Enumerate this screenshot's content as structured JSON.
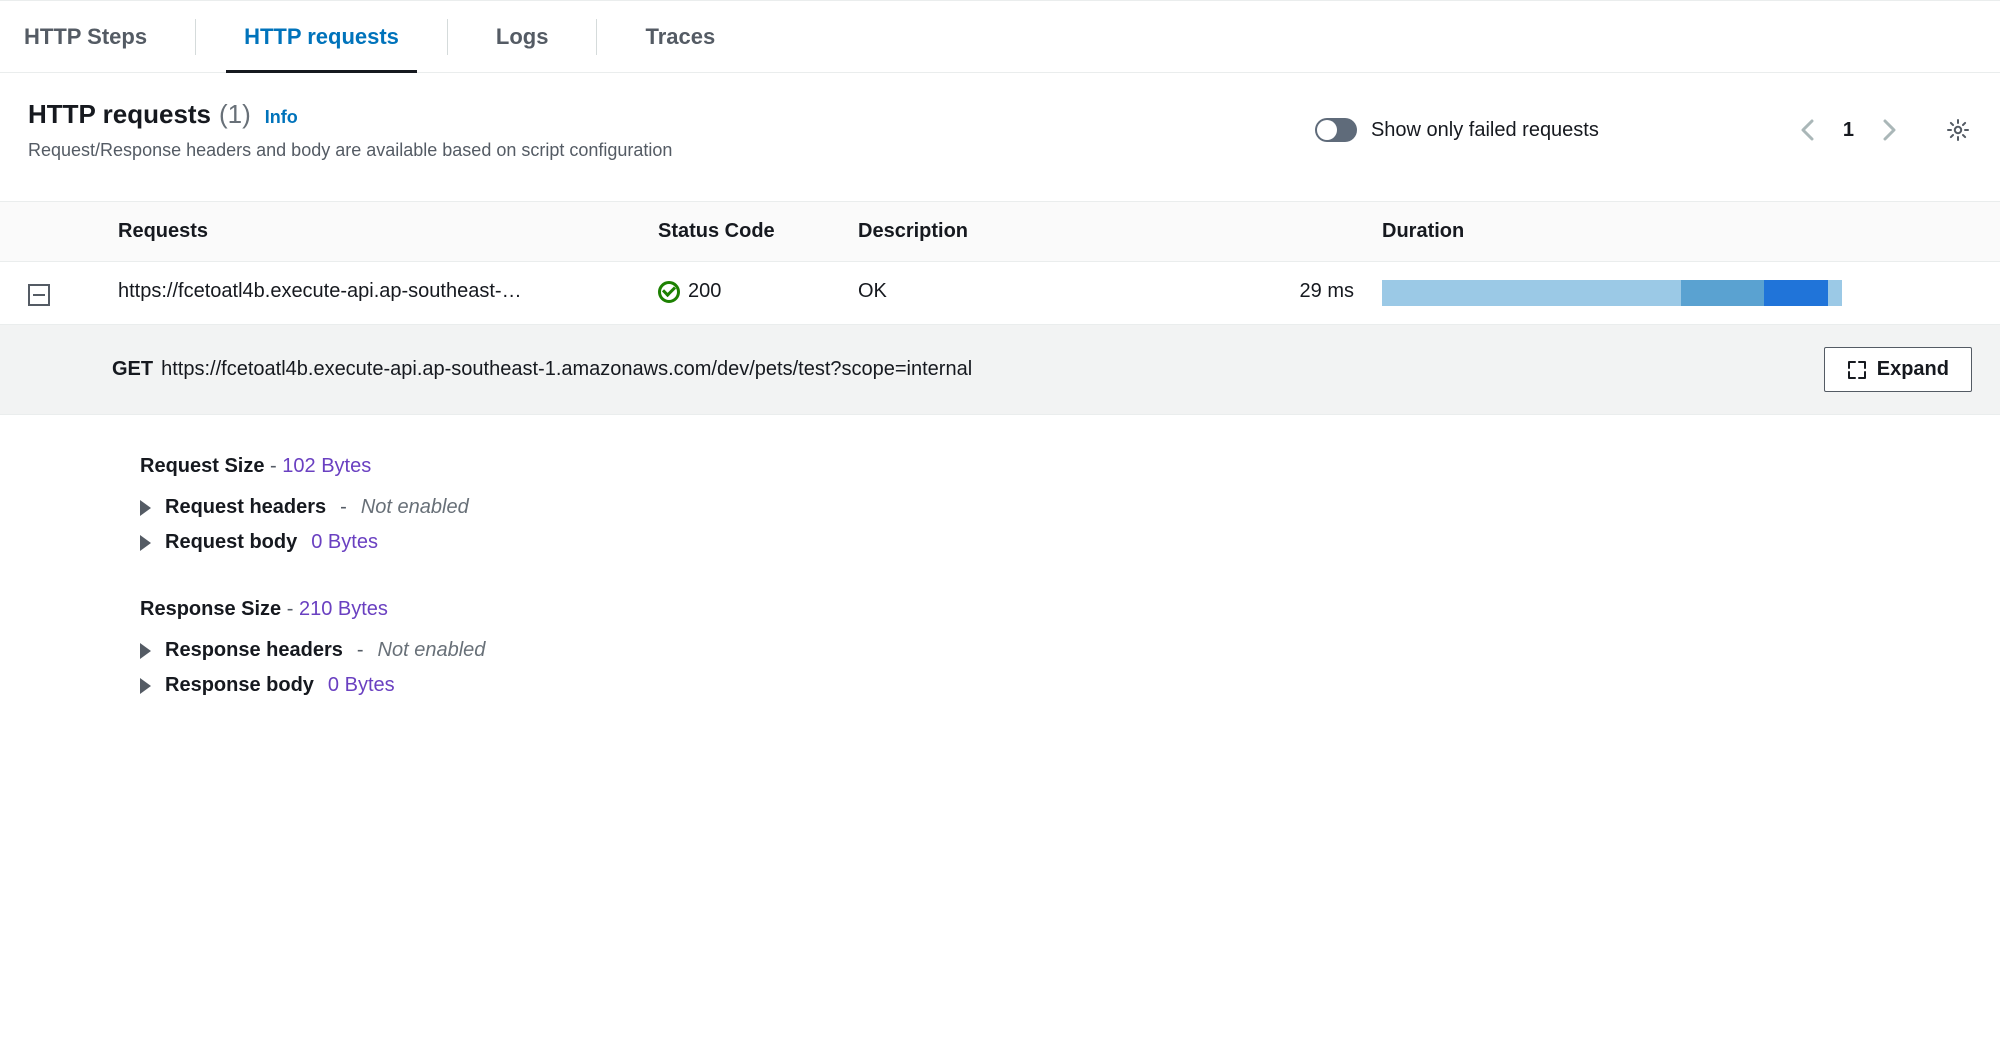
{
  "tabs": {
    "steps": "HTTP Steps",
    "requests": "HTTP requests",
    "logs": "Logs",
    "traces": "Traces"
  },
  "header": {
    "title": "HTTP requests",
    "count": "(1)",
    "info": "Info",
    "subtitle": "Request/Response headers and body are available based on script configuration",
    "toggle_label": "Show only failed requests"
  },
  "pager": {
    "page": "1"
  },
  "columns": {
    "requests": "Requests",
    "status": "Status Code",
    "description": "Description",
    "duration": "Duration"
  },
  "row": {
    "url_short": "https://fcetoatl4b.execute-api.ap-southeast-…",
    "status": "200",
    "description": "OK",
    "duration": "29 ms"
  },
  "detail": {
    "method": "GET",
    "url": "https://fcetoatl4b.execute-api.ap-southeast-1.amazonaws.com/dev/pets/test?scope=internal",
    "expand": "Expand"
  },
  "body": {
    "request": {
      "size_label": "Request Size",
      "size_value": "102 Bytes",
      "headers_label": "Request headers",
      "headers_status": "Not enabled",
      "body_label": "Request body",
      "body_value": "0 Bytes"
    },
    "response": {
      "size_label": "Response Size",
      "size_value": "210 Bytes",
      "headers_label": "Response headers",
      "headers_status": "Not enabled",
      "body_label": "Response body",
      "body_value": "0 Bytes"
    }
  }
}
